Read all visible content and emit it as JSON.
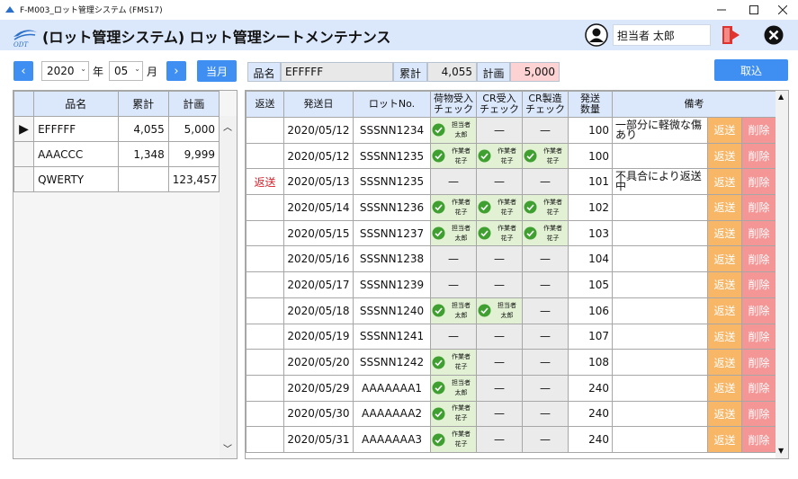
{
  "window": {
    "title": "F-M003_ロット管理システム (FMS17)"
  },
  "header": {
    "title": "(ロット管理システム) ロット管理シートメンテナンス",
    "user": "担当者 太郎"
  },
  "filters": {
    "year": "2020",
    "year_unit": "年",
    "month": "05",
    "month_unit": "月",
    "current_month": "当月",
    "product_label": "品名",
    "product_value": "EFFFFF",
    "total_label": "累計",
    "total_value": "4,055",
    "plan_label": "計画",
    "plan_value": "5,000",
    "cancel": "取込"
  },
  "left_table": {
    "headers": [
      "品名",
      "累計",
      "計画"
    ],
    "rows": [
      {
        "name": "EFFFFF",
        "total": "4,055",
        "plan": "5,000",
        "selected": true
      },
      {
        "name": "AAACCC",
        "total": "1,348",
        "plan": "9,999"
      },
      {
        "name": "QWERTY",
        "total": "",
        "plan": "123,457"
      }
    ]
  },
  "right_table": {
    "headers": [
      "返送",
      "発送日",
      "ロットNo.",
      "荷物受入\nチェック",
      "CR受入\nチェック",
      "CR製造\nチェック",
      "発送\n数量",
      "備考"
    ],
    "send_label": "返送",
    "delete_label": "削除",
    "dash": "—",
    "rows": [
      {
        "ret": "",
        "date": "2020/05/12",
        "lot": "SSSNN1234",
        "c1": [
          "担当者",
          "太郎"
        ],
        "c2": null,
        "c3": null,
        "qty": "100",
        "note": "一部分に軽微な傷あり"
      },
      {
        "ret": "",
        "date": "2020/05/12",
        "lot": "SSSNN1235",
        "c1": [
          "作業者",
          "花子"
        ],
        "c2": [
          "作業者",
          "花子"
        ],
        "c3": [
          "作業者",
          "花子"
        ],
        "qty": "100",
        "note": ""
      },
      {
        "ret": "返送",
        "date": "2020/05/13",
        "lot": "SSSNN1235",
        "c1": null,
        "c2": null,
        "c3": null,
        "qty": "101",
        "note": "不具合により返送中"
      },
      {
        "ret": "",
        "date": "2020/05/14",
        "lot": "SSSNN1236",
        "c1": [
          "作業者",
          "花子"
        ],
        "c2": [
          "作業者",
          "花子"
        ],
        "c3": [
          "作業者",
          "花子"
        ],
        "qty": "102",
        "note": ""
      },
      {
        "ret": "",
        "date": "2020/05/15",
        "lot": "SSSNN1237",
        "c1": [
          "担当者",
          "太郎"
        ],
        "c2": [
          "作業者",
          "花子"
        ],
        "c3": [
          "作業者",
          "花子"
        ],
        "qty": "103",
        "note": ""
      },
      {
        "ret": "",
        "date": "2020/05/16",
        "lot": "SSSNN1238",
        "c1": null,
        "c2": null,
        "c3": null,
        "qty": "104",
        "note": ""
      },
      {
        "ret": "",
        "date": "2020/05/17",
        "lot": "SSSNN1239",
        "c1": null,
        "c2": null,
        "c3": null,
        "qty": "105",
        "note": ""
      },
      {
        "ret": "",
        "date": "2020/05/18",
        "lot": "SSSNN1240",
        "c1": [
          "担当者",
          "太郎"
        ],
        "c2": [
          "担当者",
          "太郎"
        ],
        "c3": null,
        "qty": "106",
        "note": ""
      },
      {
        "ret": "",
        "date": "2020/05/19",
        "lot": "SSSNN1241",
        "c1": null,
        "c2": null,
        "c3": null,
        "qty": "107",
        "note": ""
      },
      {
        "ret": "",
        "date": "2020/05/20",
        "lot": "SSSNN1242",
        "c1": [
          "作業者",
          "花子"
        ],
        "c2": null,
        "c3": null,
        "qty": "108",
        "note": ""
      },
      {
        "ret": "",
        "date": "2020/05/29",
        "lot": "AAAAAAA1",
        "c1": [
          "担当者",
          "太郎"
        ],
        "c2": null,
        "c3": null,
        "qty": "240",
        "note": ""
      },
      {
        "ret": "",
        "date": "2020/05/30",
        "lot": "AAAAAAA2",
        "c1": [
          "作業者",
          "花子"
        ],
        "c2": null,
        "c3": null,
        "qty": "240",
        "note": ""
      },
      {
        "ret": "",
        "date": "2020/05/31",
        "lot": "AAAAAAA3",
        "c1": [
          "作業者",
          "花子"
        ],
        "c2": null,
        "c3": null,
        "qty": "240",
        "note": ""
      }
    ]
  },
  "colors": {
    "accent": "#3f8ff2",
    "header_bg": "#dbe7fa",
    "check_bg": "#e2f1d4",
    "check_icon": "#3fa031",
    "send_bg": "#f8b667",
    "delete_bg": "#f49596",
    "return_text": "#d9202a"
  }
}
